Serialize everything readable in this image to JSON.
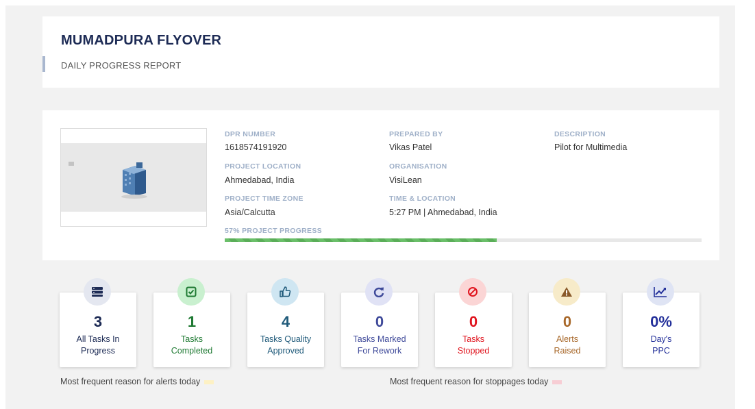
{
  "header": {
    "title": "MUMADPURA FLYOVER",
    "subtitle": "DAILY PROGRESS REPORT"
  },
  "info": {
    "dpr_number": {
      "label": "DPR NUMBER",
      "value": "1618574191920"
    },
    "prepared_by": {
      "label": "PREPARED BY",
      "value": "Vikas Patel"
    },
    "description": {
      "label": "DESCRIPTION",
      "value": "Pilot for Multimedia"
    },
    "project_location": {
      "label": "PROJECT LOCATION",
      "value": "Ahmedabad, India"
    },
    "organisation": {
      "label": "ORGANISATION",
      "value": "VisiLean"
    },
    "time_zone": {
      "label": "PROJECT TIME ZONE",
      "value": "Asia/Calcutta"
    },
    "time_location": {
      "label": "TIME & LOCATION",
      "value": "5:27 PM | Ahmedabad, India"
    },
    "progress_label": "57% PROJECT PROGRESS",
    "progress_percent": 57
  },
  "stats": [
    {
      "value": "3",
      "line1": "All Tasks In",
      "line2": "Progress",
      "icon": "list-icon",
      "color": "#1d2b55",
      "icon_bg": "#e4e7f0"
    },
    {
      "value": "1",
      "line1": "Tasks",
      "line2": "Completed",
      "icon": "check-square-icon",
      "color": "#1f7a33",
      "icon_bg": "#c9f0cf"
    },
    {
      "value": "4",
      "line1": "Tasks Quality",
      "line2": "Approved",
      "icon": "thumbs-up-icon",
      "color": "#1f5a7a",
      "icon_bg": "#cfe6f2"
    },
    {
      "value": "0",
      "line1": "Tasks Marked",
      "line2": "For Rework",
      "icon": "redo-icon",
      "color": "#3f4a9a",
      "icon_bg": "#e0e2f5"
    },
    {
      "value": "0",
      "line1": "Tasks",
      "line2": "Stopped",
      "icon": "ban-icon",
      "color": "#e0141e",
      "icon_bg": "#fbd5d5"
    },
    {
      "value": "0",
      "line1": "Alerts",
      "line2": "Raised",
      "icon": "warning-icon",
      "color": "#a8682a",
      "icon_bg": "#f7ebc9"
    },
    {
      "value": "0%",
      "line1": "Day's",
      "line2": "PPC",
      "icon": "chart-line-icon",
      "color": "#23309a",
      "icon_bg": "#dfe4f4"
    }
  ],
  "footer": {
    "alerts_reason": "Most frequent reason for alerts today",
    "stoppages_reason": "Most frequent reason for stoppages today",
    "alerts_swatch_color": "#fdf1c4",
    "stoppages_swatch_color": "#f7cdd4"
  }
}
